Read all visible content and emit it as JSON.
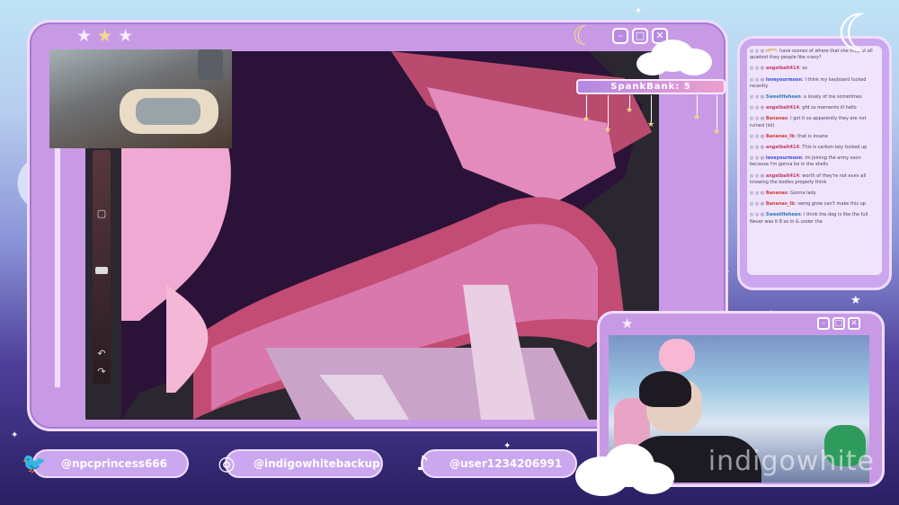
{
  "window": {
    "stars": [
      "★",
      "★",
      "★"
    ],
    "buttons": {
      "minimize": "–",
      "maximize": "□",
      "close": "✕"
    }
  },
  "banner": {
    "text": "SpankBank: 5"
  },
  "chat": {
    "messages": [
      {
        "badges": "◎ ◎ ◍",
        "user": "ri***",
        "text": ": have scenes of where that she they at all quietest they people like crazy?"
      },
      {
        "badges": "◎ ◎ ◍",
        "user": "angelbait414",
        "text": ": so"
      },
      {
        "badges": "◎ ◎ ◍",
        "user": "loveyourmoon",
        "text": ": I think my keyboard fucked recently"
      },
      {
        "badges": "◎ ◎ ◍",
        "user": "SweetHeheen",
        "text": ": a lovely of me sometimes"
      },
      {
        "badges": "◎ ◎ ◍",
        "user": "angelbait414",
        "text": ": gfd so memento ill hello"
      },
      {
        "badges": "◎ ◎ ◍",
        "user": "Bananas",
        "text": ": I got it so apparently they are not ruined (lol)"
      },
      {
        "badges": "◎ ◎ ◍",
        "user": "Bananas_Ib",
        "text": ": that is insane"
      },
      {
        "badges": "◎ ◎ ◍",
        "user": "angelbait414",
        "text": ": This is carbon-laty fucked up"
      },
      {
        "badges": "◎ ◎ ◍",
        "user": "loveyourmoon",
        "text": ": im joining the army soon because I'm gonna be in the shells"
      },
      {
        "badges": "◎ ◎ ◍",
        "user": "angelbait414",
        "text": ": worth of they're not even all knowing the bodies properly think"
      },
      {
        "badges": "◎ ◎ ◍",
        "user": "Bananas",
        "text": ": Gonna lady"
      },
      {
        "badges": "◎ ◎ ◍",
        "user": "Bananas_Ib",
        "text": ": vemg grow can't make this up"
      },
      {
        "badges": "◎ ◎ ◍",
        "user": "SweetHeheen",
        "text": ": I think the dog is like the full Never was it 8 so in & under the"
      }
    ]
  },
  "camera": {
    "buttons": {
      "minimize": "–",
      "maximize": "□",
      "close": "✕"
    },
    "watermark": "indigowhite"
  },
  "socials": [
    {
      "icon": "twitter-icon",
      "glyph": "🐦",
      "handle": "@npcprincess666"
    },
    {
      "icon": "instagram-icon",
      "glyph": "◎",
      "handle": "@indigowhitebackup"
    },
    {
      "icon": "tiktok-icon",
      "glyph": "♪",
      "handle": "@user1234206991"
    }
  ]
}
